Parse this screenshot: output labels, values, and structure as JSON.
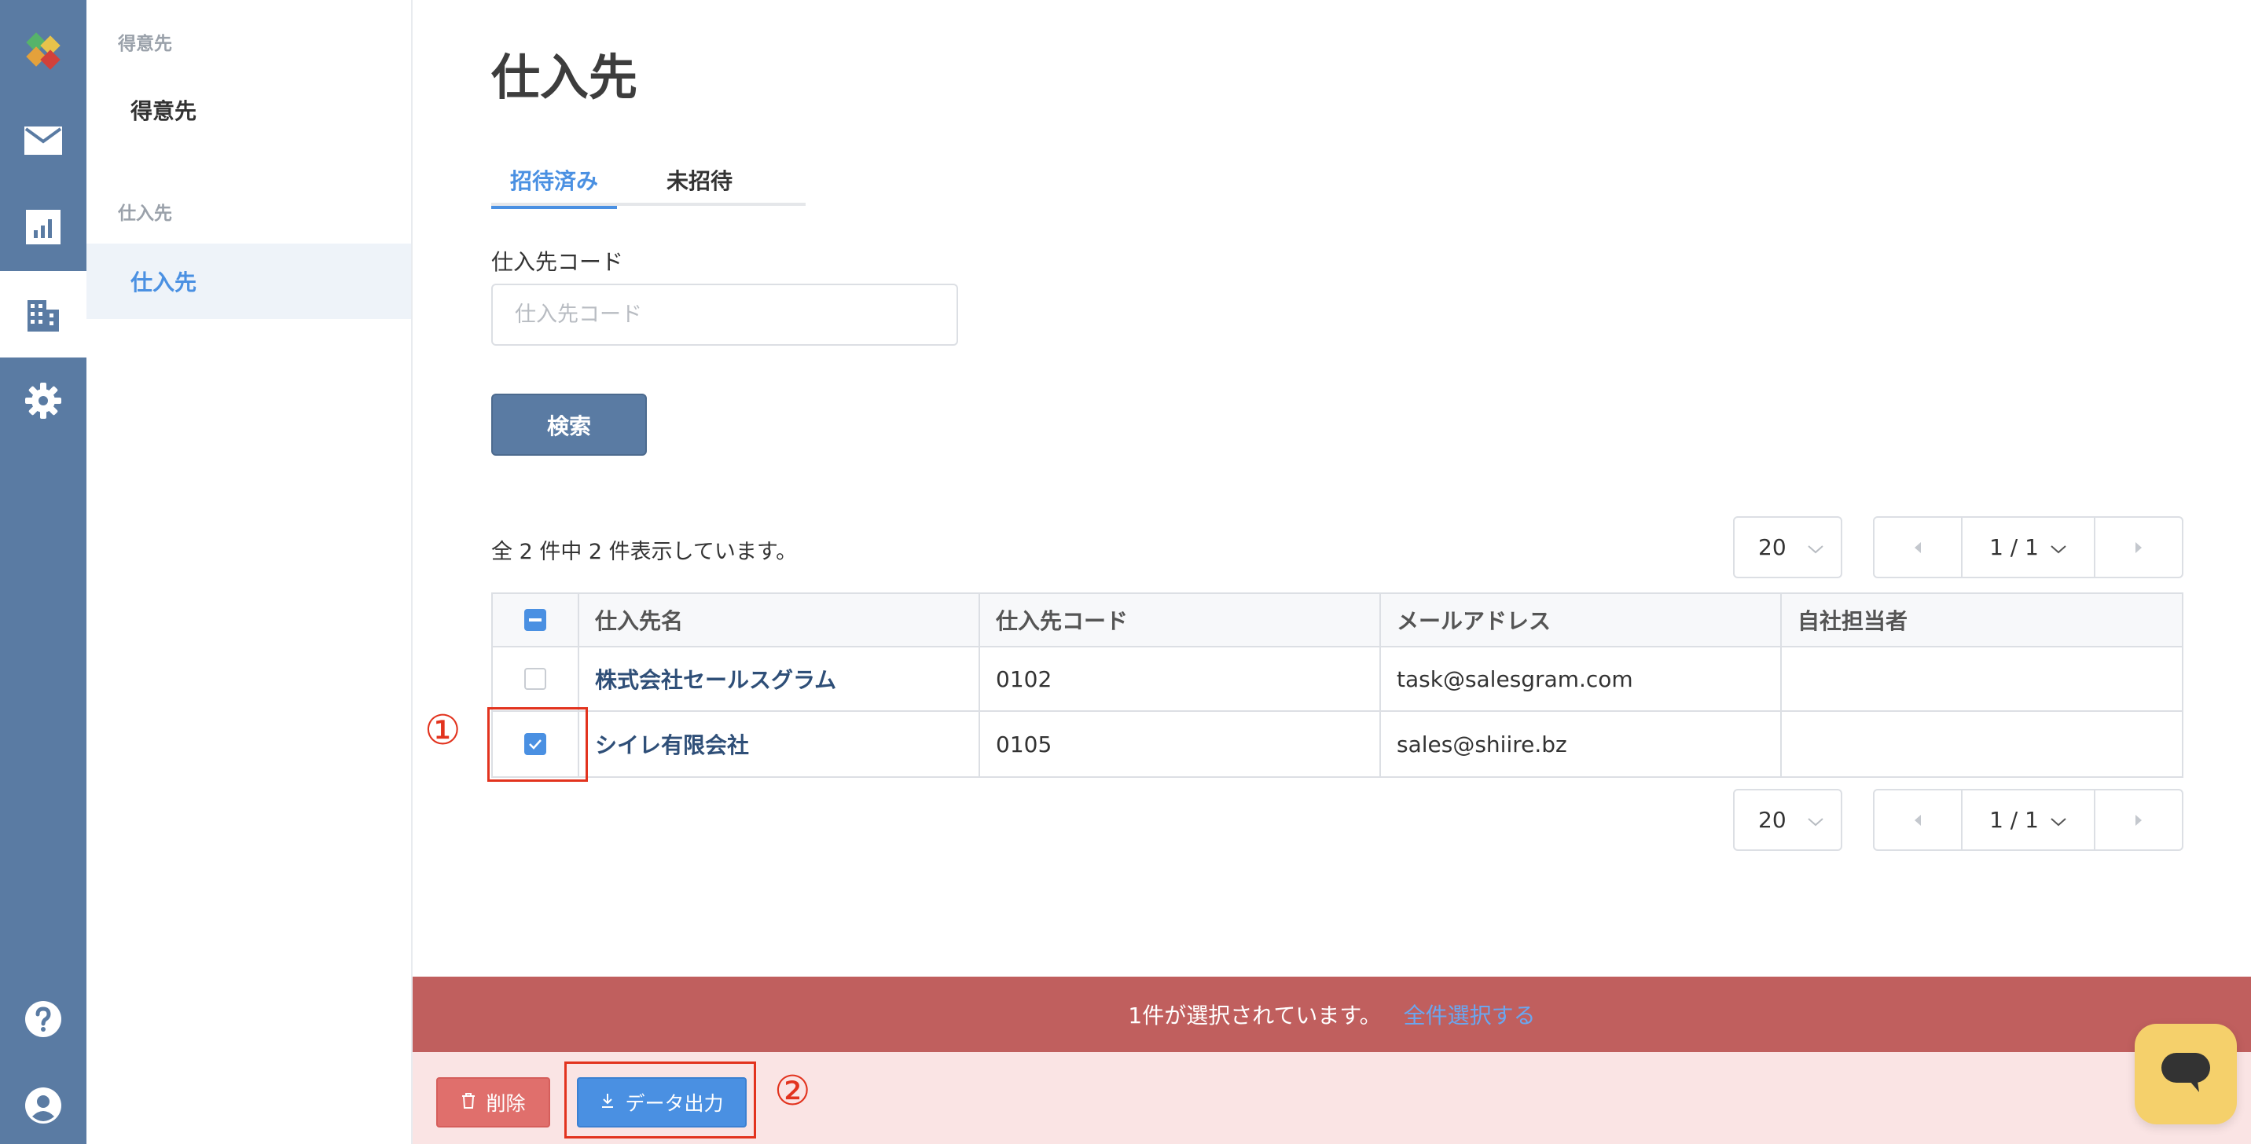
{
  "rail": {
    "icons": [
      "logo-icon",
      "mail-icon",
      "chart-icon",
      "building-icon",
      "gear-icon",
      "help-icon",
      "account-icon"
    ],
    "active": "building-icon"
  },
  "subnav": {
    "sections": [
      {
        "heading": "得意先",
        "items": [
          {
            "label": "得意先",
            "active": false
          }
        ]
      },
      {
        "heading": "仕入先",
        "items": [
          {
            "label": "仕入先",
            "active": true
          }
        ]
      }
    ]
  },
  "page": {
    "title": "仕入先",
    "tabs": [
      {
        "label": "招待済み",
        "active": true
      },
      {
        "label": "未招待",
        "active": false
      }
    ],
    "filter": {
      "label": "仕入先コード",
      "placeholder": "仕入先コード",
      "value": ""
    },
    "search_label": "検索",
    "count_text": "全 2 件中 2 件表示しています。",
    "pagination": {
      "per_page": "20",
      "page_indicator": "1 / 1"
    }
  },
  "table": {
    "columns": [
      "仕入先名",
      "仕入先コード",
      "メールアドレス",
      "自社担当者"
    ],
    "rows": [
      {
        "name": "株式会社セールスグラム",
        "code": "0102",
        "email": "task@salesgram.com",
        "owner": "",
        "checked": false
      },
      {
        "name": "シイレ有限会社",
        "code": "0105",
        "email": "sales@shiire.bz",
        "owner": "",
        "checked": true
      }
    ]
  },
  "annotations": {
    "step1": "①",
    "step2": "②"
  },
  "selection_bar": {
    "text": "1件が選択されています。",
    "select_all_link": "全件選択する"
  },
  "actions": {
    "delete_label": "削除",
    "export_label": "データ出力"
  },
  "colors": {
    "rail": "#5a7ba3",
    "accent": "#4a90e2",
    "selection_bar": "#c05f5e",
    "action_bar": "#fae4e4",
    "callout": "#e2331e",
    "chat": "#f5d06b"
  }
}
